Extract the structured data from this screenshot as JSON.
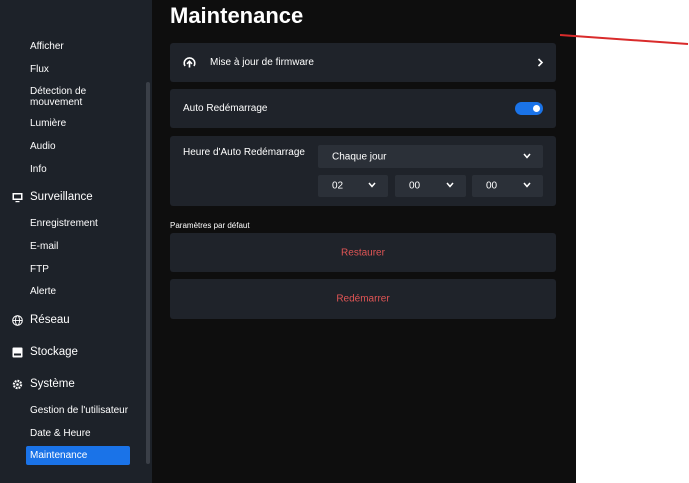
{
  "sidebar": {
    "items_top": [
      "Afficher",
      "Flux",
      "Détection de mouvement",
      "Lumière",
      "Audio",
      "Info"
    ],
    "surveillance": {
      "label": "Surveillance",
      "icon": "monitor-icon",
      "items": [
        "Enregistrement",
        "E-mail",
        "FTP",
        "Alerte"
      ]
    },
    "reseau": {
      "label": "Réseau",
      "icon": "globe-icon"
    },
    "stockage": {
      "label": "Stockage",
      "icon": "storage-icon"
    },
    "systeme": {
      "label": "Système",
      "icon": "gear-icon",
      "items": [
        "Gestion de l'utilisateur",
        "Date & Heure",
        "Maintenance"
      ]
    },
    "active_item": "Maintenance"
  },
  "main": {
    "title": "Maintenance",
    "firmware": {
      "label": "Mise à jour de firmware",
      "icon": "upload-icon"
    },
    "auto_restart": {
      "label": "Auto Redémarrage",
      "enabled": true
    },
    "auto_restart_time": {
      "label": "Heure d'Auto Redémarrage",
      "frequency": "Chaque jour",
      "hour": "02",
      "minute": "00",
      "second": "00"
    },
    "defaults_label": "Paramètres par défaut",
    "restore_label": "Restaurer",
    "reboot_label": "Redémarrer"
  },
  "colors": {
    "accent": "#1a73e8",
    "danger_text": "#e05555",
    "sidebar_bg": "#1d2229",
    "main_bg": "#0e0e0e",
    "card_bg": "#1f232a",
    "annotation_line": "#d92b2b"
  }
}
